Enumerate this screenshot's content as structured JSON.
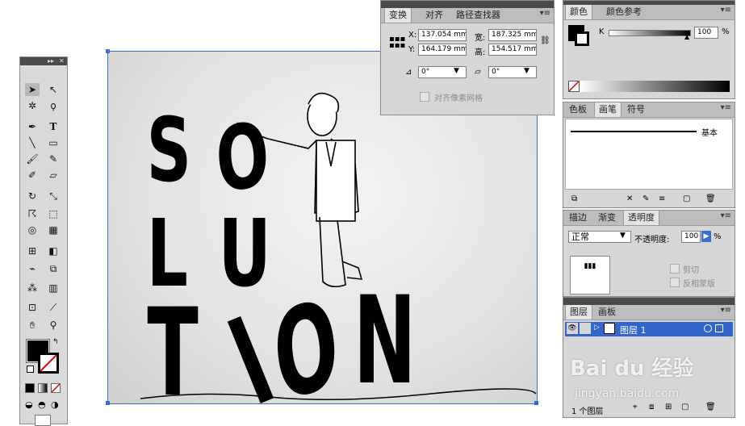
{
  "transform_panel": {
    "tabs": [
      "变换",
      "对齐",
      "路径查找器"
    ],
    "x_label": "X:",
    "x_value": "137.054 mm",
    "y_label": "Y:",
    "y_value": "164.179 mm",
    "w_label": "宽:",
    "w_value": "187.325 mm",
    "h_label": "高:",
    "h_value": "154.517 mm",
    "rotate_value": "0°",
    "shear_value": "0°",
    "align_pixel_label": "对齐像素网格"
  },
  "color_panel": {
    "tabs": [
      "颜色",
      "颜色参考"
    ],
    "channel_label": "K",
    "channel_value": "100",
    "percent": "%"
  },
  "brush_panel": {
    "tabs": [
      "色板",
      "画笔",
      "符号"
    ],
    "brush_name": "基本"
  },
  "transparency_panel": {
    "tabs": [
      "描边",
      "渐变",
      "透明度"
    ],
    "blend_mode": "正常",
    "opacity_label": "不透明度:",
    "opacity_value": "100",
    "percent": "%",
    "clip_label": "剪切",
    "invert_label": "反相蒙版"
  },
  "layers_panel": {
    "tabs": [
      "图层",
      "画板"
    ],
    "layer_name": "图层 1",
    "footer_count": "1 个图层"
  },
  "artwork": {
    "letters": [
      "S",
      "O",
      "L",
      "U",
      "T",
      "I",
      "O",
      "N"
    ]
  },
  "watermark": {
    "brand": "Bai du 经验",
    "url": "jingyan.baidu.com"
  },
  "colors": {
    "selection_blue": "#3b6ccf",
    "panel_bg": "#d6d6d6",
    "layer_highlight": "#3366cc"
  }
}
